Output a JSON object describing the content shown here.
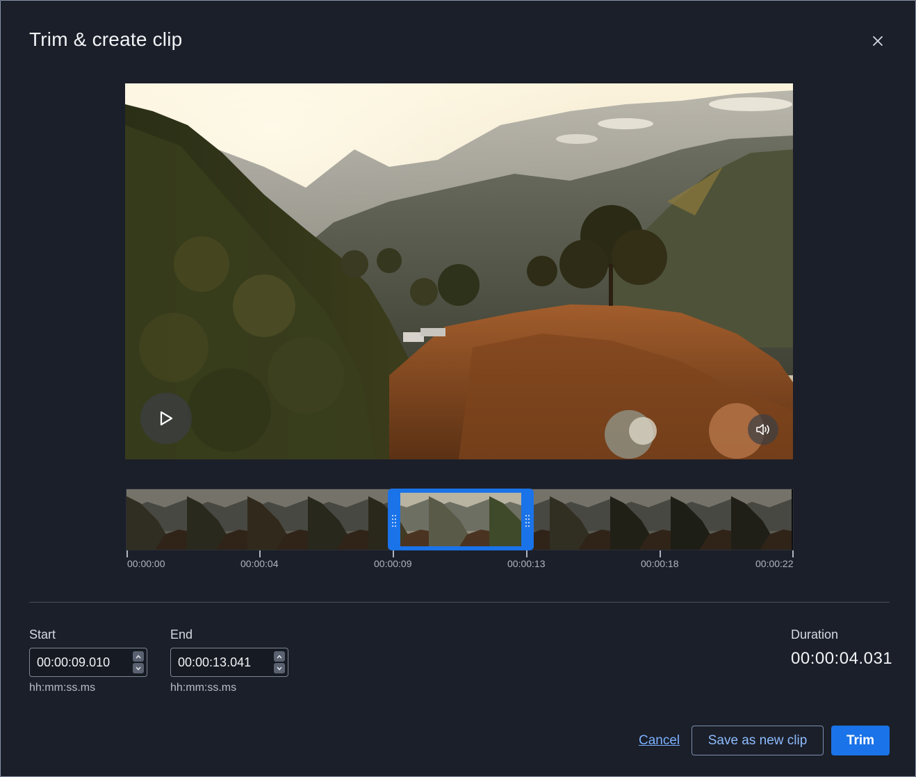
{
  "dialog": {
    "title": "Trim & create clip",
    "close_icon": "close-icon"
  },
  "player": {
    "play_icon": "play-icon",
    "volume_icon": "volume-icon"
  },
  "timeline": {
    "ticks": [
      "00:00:00",
      "00:00:04",
      "00:00:09",
      "00:00:13",
      "00:00:18",
      "00:00:22"
    ],
    "selection_start_fraction": 0.4,
    "selection_end_fraction": 0.6
  },
  "form": {
    "start": {
      "label": "Start",
      "value": "00:00:09.010",
      "hint": "hh:mm:ss.ms"
    },
    "end": {
      "label": "End",
      "value": "00:00:13.041",
      "hint": "hh:mm:ss.ms"
    },
    "duration": {
      "label": "Duration",
      "value": "00:00:04.031"
    }
  },
  "actions": {
    "cancel": "Cancel",
    "save_new": "Save as new clip",
    "trim": "Trim"
  },
  "colors": {
    "accent": "#1a73e8",
    "link": "#7bb0ff",
    "background": "#1b1f29"
  }
}
